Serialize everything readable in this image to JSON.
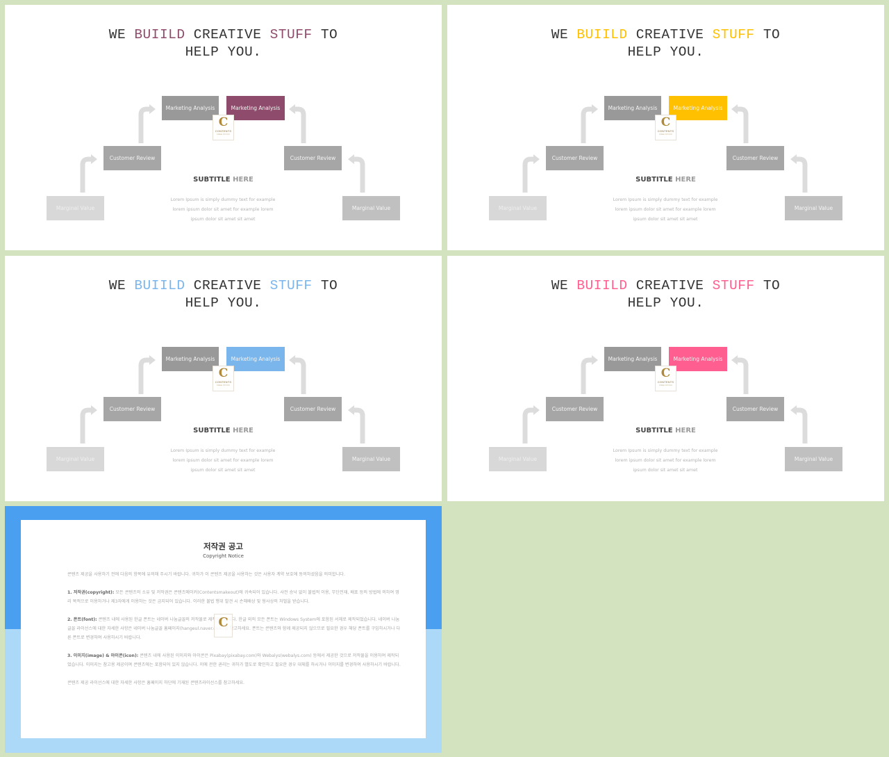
{
  "slides": [
    {
      "accent": "#8e4b6b",
      "title": {
        "w1": "WE ",
        "w2": "BUIILD",
        "w3": " CREATIVE ",
        "w4": "STUFF",
        "w5": " TO",
        "line2": "HELP YOU."
      },
      "boxes": {
        "marketing_left": "Marketing Analysis",
        "marketing_right": "Marketing Analysis",
        "customer_left": "Customer Review",
        "customer_right": "Customer Review",
        "marginal_left": "Marginal Value",
        "marginal_right": "Marginal Value"
      },
      "logo": {
        "letter": "C",
        "line1": "CONTENTS",
        "line2": "FREE STOCK"
      },
      "subtitle": {
        "bold": "SUBTITLE",
        "light": " HERE"
      },
      "body": [
        "Lorem Ipsum is simply dummy  text for example",
        "lorem ipsum dolor sit amet for example lorem",
        "ipsum dolor sit amet sit amet"
      ]
    },
    {
      "accent": "#ffc000",
      "title": {
        "w1": "WE ",
        "w2": "BUIILD",
        "w3": " CREATIVE ",
        "w4": "STUFF",
        "w5": " TO",
        "line2": "HELP YOU."
      },
      "boxes": {
        "marketing_left": "Marketing Analysis",
        "marketing_right": "Marketing Analysis",
        "customer_left": "Customer Review",
        "customer_right": "Customer Review",
        "marginal_left": "Marginal Value",
        "marginal_right": "Marginal Value"
      },
      "logo": {
        "letter": "C",
        "line1": "CONTENTS",
        "line2": "FREE STOCK"
      },
      "subtitle": {
        "bold": "SUBTITLE",
        "light": " HERE"
      },
      "body": [
        "Lorem Ipsum is simply dummy  text for example",
        "lorem ipsum dolor sit amet for example lorem",
        "ipsum dolor sit amet sit amet"
      ]
    },
    {
      "accent": "#7ab6ec",
      "title": {
        "w1": "WE ",
        "w2": "BUIILD",
        "w3": " CREATIVE ",
        "w4": "STUFF",
        "w5": " TO",
        "line2": "HELP YOU."
      },
      "boxes": {
        "marketing_left": "Marketing Analysis",
        "marketing_right": "Marketing Analysis",
        "customer_left": "Customer Review",
        "customer_right": "Customer Review",
        "marginal_left": "Marginal Value",
        "marginal_right": "Marginal Value"
      },
      "logo": {
        "letter": "C",
        "line1": "CONTENTS",
        "line2": "FREE STOCK"
      },
      "subtitle": {
        "bold": "SUBTITLE",
        "light": " HERE"
      },
      "body": [
        "Lorem Ipsum is simply dummy  text for example",
        "lorem ipsum dolor sit amet for example lorem",
        "ipsum dolor sit amet sit amet"
      ]
    },
    {
      "accent": "#ff5f90",
      "title": {
        "w1": "WE ",
        "w2": "BUIILD",
        "w3": " CREATIVE ",
        "w4": "STUFF",
        "w5": " TO",
        "line2": "HELP YOU."
      },
      "boxes": {
        "marketing_left": "Marketing Analysis",
        "marketing_right": "Marketing Analysis",
        "customer_left": "Customer Review",
        "customer_right": "Customer Review",
        "marginal_left": "Marginal Value",
        "marginal_right": "Marginal Value"
      },
      "logo": {
        "letter": "C",
        "line1": "CONTENTS",
        "line2": "FREE STOCK"
      },
      "subtitle": {
        "bold": "SUBTITLE",
        "light": " HERE"
      },
      "body": [
        "Lorem Ipsum is simply dummy  text for example",
        "lorem ipsum dolor sit amet for example lorem",
        "ipsum dolor sit amet sit amet"
      ]
    }
  ],
  "copyright": {
    "title": "저작권 공고",
    "subtitle": "Copyright Notice",
    "intro": "콘텐츠 제공을 사용하기 전에 다음의 항목에 유의해 주시기 바랍니다. 귀하가 이 콘텐츠 제공을 사용하는 것은 사용자 계약 보호에 동의하셨음을 의미합니다.",
    "sections": [
      {
        "label": "1. 저작권(copyright):",
        "text": " 모든 콘텐츠의 소유 및 저작권은 콘텐츠메이커(Contentsmakeout)에 귀속되어 있습니다. 사전 승낙 없이 불법적 이용, 무단전재, 배포 등의 방법에 의하여 영리 목적으로 이용하거나 제3자에게 이용하는 것은 금지되어 있습니다. 이러한 불법 행위 발견 시 손해배상 및 형사상의 처벌을 받습니다."
      },
      {
        "label": "2. 폰트(font):",
        "text": " 콘텐츠 내에 사용된 한글 폰트는 네이버 나눔글꼴의 저작물로 제작되었습니다. 한글 외의 모든 폰트는 Windows System에 포함된 서체로 제작되었습니다. 네이버 나눔글꼴 라이선스에 대한 자세한 사항은 네이버 나눔글꼴 홈페이지(hangeul.naver.com)를 참고하세요. 폰트는 콘텐츠와 함께 제공되지 않으므로 필요한 경우 해당 폰트를 구입하시거나 다른 폰트로 변경하여 사용하시기 바랍니다."
      },
      {
        "label": "3. 이미지(image) & 아이콘(icon):",
        "text": " 콘텐츠 내에 사용된 이미지와 아이콘은 Pixabay(pixabay.com)와 Webalys(webalys.com) 등에서 제공한 것으로 저작물을 이용하여 제작되었습니다. 이미지는 참고용 제공이며 콘텐츠에는 포함되어 있지 않습니다. 이에 관한 권리는 귀하가 별도로 확인하고 필요한 경우 대체를 하시거나 이미지를 변경하여 사용하시기 바랍니다."
      }
    ],
    "footer": "콘텐츠 제공 라이선스에 대한 자세한 사항은 홈페이지 하단에 기재된 콘텐츠라이선스를 참고하세요.",
    "watermark": "C"
  }
}
